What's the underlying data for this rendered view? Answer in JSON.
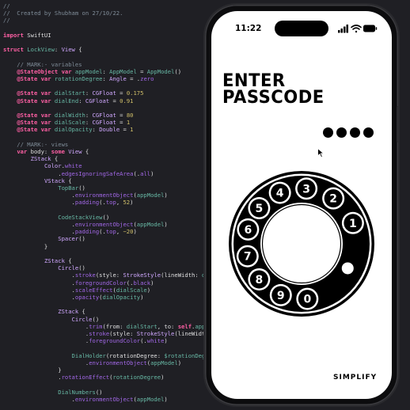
{
  "editor": {
    "lines": [
      [
        [
          "com",
          "//"
        ]
      ],
      [
        [
          "com",
          "//  Created by Shubham on 27/10/22."
        ]
      ],
      [
        [
          "com",
          "//"
        ]
      ],
      [],
      [
        [
          "kw",
          "import"
        ],
        [
          "plain",
          " SwiftUI"
        ]
      ],
      [],
      [
        [
          "kw",
          "struct"
        ],
        [
          "plain",
          " "
        ],
        [
          "fn",
          "LockView"
        ],
        [
          "plain",
          ": "
        ],
        [
          "typ",
          "View"
        ],
        [
          "plain",
          " {"
        ]
      ],
      [],
      [
        [
          "com",
          "    // MARK:- variables"
        ]
      ],
      [
        [
          "plain",
          "    "
        ],
        [
          "kw",
          "@StateObject"
        ],
        [
          "plain",
          " "
        ],
        [
          "kw",
          "var"
        ],
        [
          "plain",
          " "
        ],
        [
          "fn",
          "appModel"
        ],
        [
          "plain",
          ": "
        ],
        [
          "fn",
          "AppModel"
        ],
        [
          "plain",
          " = "
        ],
        [
          "fn",
          "AppModel"
        ],
        [
          "plain",
          "()"
        ]
      ],
      [
        [
          "plain",
          "    "
        ],
        [
          "kw",
          "@State"
        ],
        [
          "plain",
          " "
        ],
        [
          "kw",
          "var"
        ],
        [
          "plain",
          " "
        ],
        [
          "fn",
          "rotationDegree"
        ],
        [
          "plain",
          ": "
        ],
        [
          "typ",
          "Angle"
        ],
        [
          "plain",
          " = ."
        ],
        [
          "prop",
          "zero"
        ]
      ],
      [],
      [
        [
          "plain",
          "    "
        ],
        [
          "kw",
          "@State"
        ],
        [
          "plain",
          " "
        ],
        [
          "kw",
          "var"
        ],
        [
          "plain",
          " "
        ],
        [
          "fn",
          "dialStart"
        ],
        [
          "plain",
          ": "
        ],
        [
          "typ",
          "CGFloat"
        ],
        [
          "plain",
          " = "
        ],
        [
          "num",
          "0.175"
        ]
      ],
      [
        [
          "plain",
          "    "
        ],
        [
          "kw",
          "@State"
        ],
        [
          "plain",
          " "
        ],
        [
          "kw",
          "var"
        ],
        [
          "plain",
          " "
        ],
        [
          "fn",
          "dialEnd"
        ],
        [
          "plain",
          ": "
        ],
        [
          "typ",
          "CGFloat"
        ],
        [
          "plain",
          " = "
        ],
        [
          "num",
          "0.91"
        ]
      ],
      [],
      [
        [
          "plain",
          "    "
        ],
        [
          "kw",
          "@State"
        ],
        [
          "plain",
          " "
        ],
        [
          "kw",
          "var"
        ],
        [
          "plain",
          " "
        ],
        [
          "fn",
          "dialWidth"
        ],
        [
          "plain",
          ": "
        ],
        [
          "typ",
          "CGFloat"
        ],
        [
          "plain",
          " = "
        ],
        [
          "num",
          "80"
        ]
      ],
      [
        [
          "plain",
          "    "
        ],
        [
          "kw",
          "@State"
        ],
        [
          "plain",
          " "
        ],
        [
          "kw",
          "var"
        ],
        [
          "plain",
          " "
        ],
        [
          "fn",
          "dialScale"
        ],
        [
          "plain",
          ": "
        ],
        [
          "typ",
          "CGFloat"
        ],
        [
          "plain",
          " = "
        ],
        [
          "num",
          "1"
        ]
      ],
      [
        [
          "plain",
          "    "
        ],
        [
          "kw",
          "@State"
        ],
        [
          "plain",
          " "
        ],
        [
          "kw",
          "var"
        ],
        [
          "plain",
          " "
        ],
        [
          "fn",
          "dialOpacity"
        ],
        [
          "plain",
          ": "
        ],
        [
          "typ",
          "Double"
        ],
        [
          "plain",
          " = "
        ],
        [
          "num",
          "1"
        ]
      ],
      [],
      [
        [
          "com",
          "    // MARK:- views"
        ]
      ],
      [
        [
          "plain",
          "    "
        ],
        [
          "kw",
          "var"
        ],
        [
          "plain",
          " body: "
        ],
        [
          "kw",
          "some"
        ],
        [
          "plain",
          " "
        ],
        [
          "typ",
          "View"
        ],
        [
          "plain",
          " {"
        ]
      ],
      [
        [
          "plain",
          "        "
        ],
        [
          "typ",
          "ZStack"
        ],
        [
          "plain",
          " {"
        ]
      ],
      [
        [
          "plain",
          "            "
        ],
        [
          "typ",
          "Color"
        ],
        [
          "plain",
          "."
        ],
        [
          "prop",
          "white"
        ]
      ],
      [
        [
          "plain",
          "                ."
        ],
        [
          "prop",
          "edgesIgnoringSafeArea"
        ],
        [
          "plain",
          "(."
        ],
        [
          "prop",
          "all"
        ],
        [
          "plain",
          ")"
        ]
      ],
      [
        [
          "plain",
          "            "
        ],
        [
          "typ",
          "VStack"
        ],
        [
          "plain",
          " {"
        ]
      ],
      [
        [
          "plain",
          "                "
        ],
        [
          "fn",
          "TopBar"
        ],
        [
          "plain",
          "()"
        ]
      ],
      [
        [
          "plain",
          "                    ."
        ],
        [
          "prop",
          "environmentObject"
        ],
        [
          "plain",
          "("
        ],
        [
          "fn",
          "appModel"
        ],
        [
          "plain",
          ")"
        ]
      ],
      [
        [
          "plain",
          "                    ."
        ],
        [
          "prop",
          "padding"
        ],
        [
          "plain",
          "(."
        ],
        [
          "prop",
          "top"
        ],
        [
          "plain",
          ", "
        ],
        [
          "num",
          "52"
        ],
        [
          "plain",
          ")"
        ]
      ],
      [],
      [
        [
          "plain",
          "                "
        ],
        [
          "fn",
          "CodeStackView"
        ],
        [
          "plain",
          "()"
        ]
      ],
      [
        [
          "plain",
          "                    ."
        ],
        [
          "prop",
          "environmentObject"
        ],
        [
          "plain",
          "("
        ],
        [
          "fn",
          "appModel"
        ],
        [
          "plain",
          ")"
        ]
      ],
      [
        [
          "plain",
          "                    ."
        ],
        [
          "prop",
          "padding"
        ],
        [
          "plain",
          "(."
        ],
        [
          "prop",
          "top"
        ],
        [
          "plain",
          ", "
        ],
        [
          "num",
          "−20"
        ],
        [
          "plain",
          ")"
        ]
      ],
      [
        [
          "plain",
          "                "
        ],
        [
          "typ",
          "Spacer"
        ],
        [
          "plain",
          "()"
        ]
      ],
      [
        [
          "plain",
          "            }"
        ]
      ],
      [],
      [
        [
          "plain",
          "            "
        ],
        [
          "typ",
          "ZStack"
        ],
        [
          "plain",
          " {"
        ]
      ],
      [
        [
          "plain",
          "                "
        ],
        [
          "typ",
          "Circle"
        ],
        [
          "plain",
          "()"
        ]
      ],
      [
        [
          "plain",
          "                    ."
        ],
        [
          "prop",
          "stroke"
        ],
        [
          "plain",
          "(style: "
        ],
        [
          "typ",
          "StrokeStyle"
        ],
        [
          "plain",
          "(lineWidth: "
        ],
        [
          "fn",
          "dialWid"
        ]
      ],
      [
        [
          "plain",
          "                    ."
        ],
        [
          "prop",
          "foregroundColor"
        ],
        [
          "plain",
          "(."
        ],
        [
          "prop",
          "black"
        ],
        [
          "plain",
          ")"
        ]
      ],
      [
        [
          "plain",
          "                    ."
        ],
        [
          "prop",
          "scaleEffect"
        ],
        [
          "plain",
          "("
        ],
        [
          "fn",
          "dialScale"
        ],
        [
          "plain",
          ")"
        ]
      ],
      [
        [
          "plain",
          "                    ."
        ],
        [
          "prop",
          "opacity"
        ],
        [
          "plain",
          "("
        ],
        [
          "fn",
          "dialOpacity"
        ],
        [
          "plain",
          ")"
        ]
      ],
      [],
      [
        [
          "plain",
          "                "
        ],
        [
          "typ",
          "ZStack"
        ],
        [
          "plain",
          " {"
        ]
      ],
      [
        [
          "plain",
          "                    "
        ],
        [
          "typ",
          "Circle"
        ],
        [
          "plain",
          "()"
        ]
      ],
      [
        [
          "plain",
          "                        ."
        ],
        [
          "prop",
          "trim"
        ],
        [
          "plain",
          "(from: "
        ],
        [
          "fn",
          "dialStart"
        ],
        [
          "plain",
          ", to: "
        ],
        [
          "kw",
          "self"
        ],
        [
          "plain",
          "."
        ],
        [
          "fn",
          "appModel."
        ]
      ],
      [
        [
          "plain",
          "                        ."
        ],
        [
          "prop",
          "stroke"
        ],
        [
          "plain",
          "(style: "
        ],
        [
          "typ",
          "StrokeStyle"
        ],
        [
          "plain",
          "(lineWidth: "
        ],
        [
          "num",
          "70"
        ],
        [
          "plain",
          ","
        ]
      ],
      [
        [
          "plain",
          "                        ."
        ],
        [
          "prop",
          "foregroundColor"
        ],
        [
          "plain",
          "(."
        ],
        [
          "prop",
          "white"
        ],
        [
          "plain",
          ")"
        ]
      ],
      [],
      [
        [
          "plain",
          "                    "
        ],
        [
          "fn",
          "DialHolder"
        ],
        [
          "plain",
          "(rotationDegree: "
        ],
        [
          "fn",
          "$rotationDegree"
        ],
        [
          "plain",
          ")"
        ]
      ],
      [
        [
          "plain",
          "                        ."
        ],
        [
          "prop",
          "environmentObject"
        ],
        [
          "plain",
          "("
        ],
        [
          "fn",
          "appModel"
        ],
        [
          "plain",
          ")"
        ]
      ],
      [
        [
          "plain",
          "                }"
        ]
      ],
      [
        [
          "plain",
          "                ."
        ],
        [
          "prop",
          "rotationEffect"
        ],
        [
          "plain",
          "("
        ],
        [
          "fn",
          "rotationDegree"
        ],
        [
          "plain",
          ")"
        ]
      ],
      [],
      [
        [
          "plain",
          "                "
        ],
        [
          "fn",
          "DialNumbers"
        ],
        [
          "plain",
          "()"
        ]
      ],
      [
        [
          "plain",
          "                    ."
        ],
        [
          "prop",
          "environmentObject"
        ],
        [
          "plain",
          "("
        ],
        [
          "fn",
          "appModel"
        ],
        [
          "plain",
          ")"
        ]
      ]
    ]
  },
  "phone": {
    "status": {
      "time": "11:22",
      "icons": [
        "signal-icon",
        "wifi-icon",
        "battery-icon"
      ]
    },
    "title_line1": "ENTER",
    "title_line2": "PASSCODE",
    "passcode_dots": 4,
    "dial_numbers": [
      "1",
      "2",
      "3",
      "4",
      "5",
      "6",
      "7",
      "8",
      "9",
      "0"
    ],
    "brand": "SIMPLIFY"
  }
}
